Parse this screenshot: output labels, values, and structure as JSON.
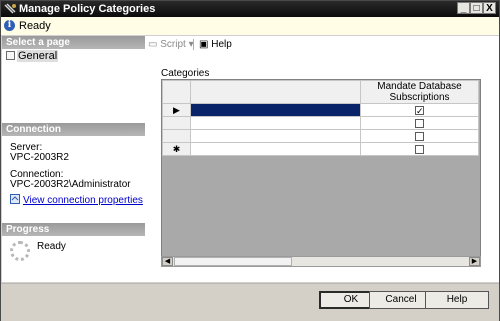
{
  "window": {
    "title": "Manage Policy Categories",
    "icon": "policy-categories-icon"
  },
  "title_buttons": {
    "minimize": "_",
    "maximize": "□",
    "close": "X"
  },
  "status": {
    "icon": "info-icon",
    "text": "Ready"
  },
  "left": {
    "select_page_header": "Select a page",
    "pages": [
      {
        "label": "General",
        "icon": "page-icon"
      }
    ],
    "connection_header": "Connection",
    "server_label": "Server:",
    "server_value": "VPC-2003R2",
    "connection_label": "Connection:",
    "connection_value": "VPC-2003R2\\Administrator",
    "view_connection_link": "View connection properties",
    "progress_header": "Progress",
    "progress_status": "Ready"
  },
  "toolbar": {
    "script_label": "Script",
    "help_label": "Help"
  },
  "categories": {
    "label": "Categories",
    "columns": [
      "",
      "Mandate Database Subscriptions"
    ],
    "rows": [
      {
        "indicator": "▶",
        "name": "",
        "mandate": true,
        "selected": true
      },
      {
        "indicator": "",
        "name": "",
        "mandate": false,
        "selected": false
      },
      {
        "indicator": "",
        "name": "",
        "mandate": false,
        "selected": false
      },
      {
        "indicator": "✱",
        "name": "",
        "mandate": false,
        "selected": false
      }
    ]
  },
  "buttons": {
    "ok": "OK",
    "cancel": "Cancel",
    "help": "Help"
  },
  "colors": {
    "title_bar": "#0b0b0b",
    "selected_cell": "#0a246a",
    "status_bg": "#fffde6"
  }
}
